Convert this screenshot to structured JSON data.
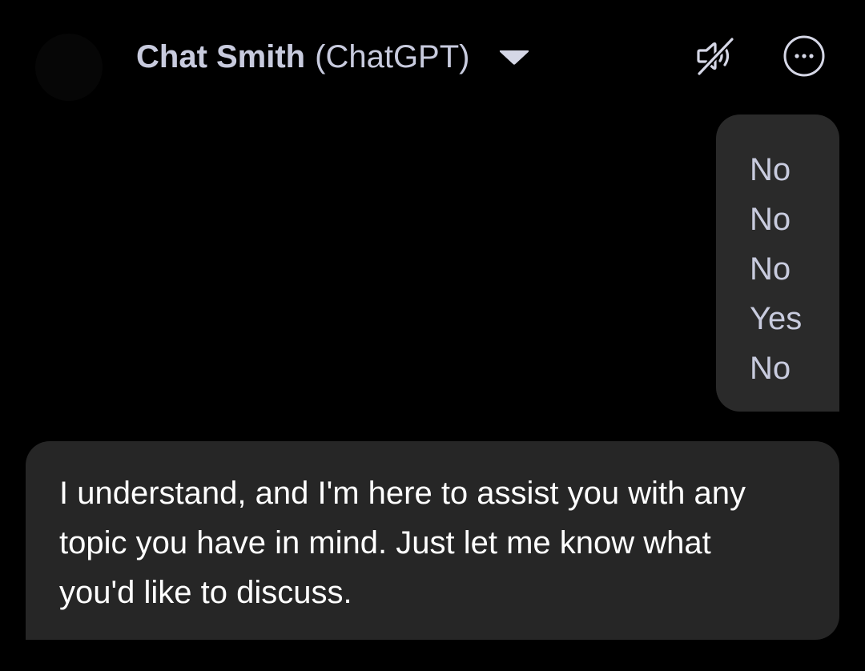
{
  "header": {
    "bot_name": "Chat Smith",
    "bot_model": "(ChatGPT)",
    "icons": {
      "dropdown": "chevron-down-icon",
      "mute": "speaker-muted-icon",
      "more": "more-options-icon"
    }
  },
  "messages": {
    "user": {
      "lines": [
        "No",
        "No",
        "No",
        "Yes",
        "No"
      ]
    },
    "assistant": {
      "text": "I understand, and I'm here to assist you with any topic you have in mind. Just let me know what you'd like to discuss."
    }
  },
  "colors": {
    "background": "#000000",
    "user_bubble": "#2a2a2a",
    "assistant_bubble": "#262626",
    "header_text": "#c8cbde",
    "icon": "#d5d7e6"
  }
}
